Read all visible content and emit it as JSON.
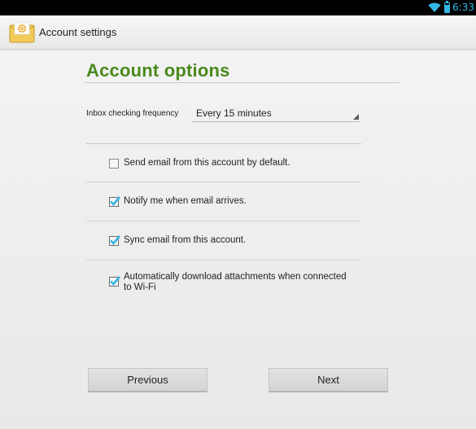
{
  "status_bar": {
    "time": "6:33",
    "wifi_icon": "wifi-icon",
    "battery_icon": "battery-icon",
    "accent_color": "#33b5e5"
  },
  "action_bar": {
    "app_icon": "email-app-icon",
    "title": "Account settings"
  },
  "section": {
    "title": "Account options",
    "title_color": "#4a8a1c"
  },
  "frequency": {
    "label": "Inbox checking frequency",
    "selected": "Every 15 minutes"
  },
  "options": [
    {
      "label": "Send email from this account by default.",
      "checked": false
    },
    {
      "label": "Notify me when email arrives.",
      "checked": true
    },
    {
      "label": "Sync email from this account.",
      "checked": true
    },
    {
      "label_line1": "Automatically download attachments when connected",
      "label_line2": "to Wi-Fi",
      "checked": true
    }
  ],
  "buttons": {
    "previous": "Previous",
    "next": "Next"
  },
  "check_color": "#33b5e5"
}
